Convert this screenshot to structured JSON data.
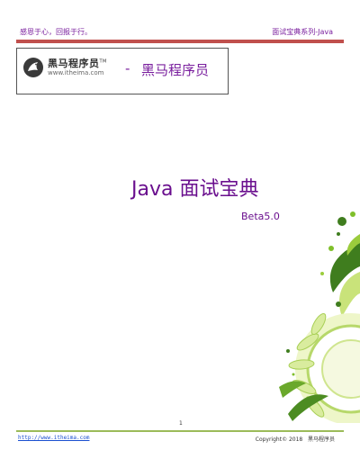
{
  "header": {
    "left_text": "感恩于心，回报于行。",
    "right_text": "面试宝典系列-Java"
  },
  "logo": {
    "brand_cn": "黑马程序员",
    "trademark": "TM",
    "url": "www.itheima.com",
    "dash": "-",
    "org_name": "黑马程序员"
  },
  "document": {
    "title": "Java 面试宝典",
    "version": "Beta5.0"
  },
  "footer": {
    "page_number": "1",
    "link": "http://www.itheima.com",
    "copyright": "Copyright© 2018",
    "org": "黑马程序员"
  },
  "colors": {
    "accent_purple": "#6a0f8e",
    "header_rule": "#c0504d",
    "footer_rule": "#9bbb59"
  }
}
